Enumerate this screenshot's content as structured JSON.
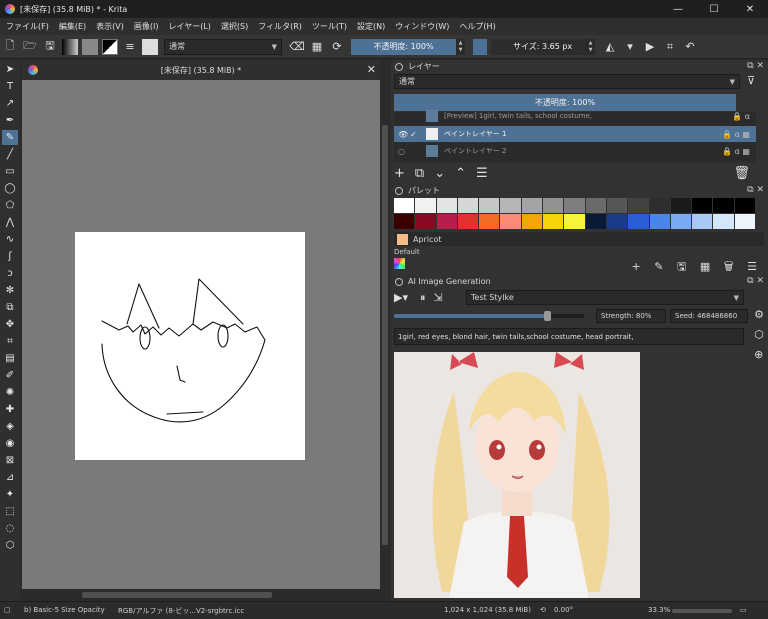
{
  "title_bar": {
    "title": "[未保存] (35.8 MiB) * - Krita",
    "minimize": "—",
    "maximize": "☐",
    "close": "✕"
  },
  "menu": [
    "ファイル(F)",
    "編集(E)",
    "表示(V)",
    "画像(I)",
    "レイヤー(L)",
    "選択(S)",
    "フィルタ(R)",
    "ツール(T)",
    "設定(N)",
    "ウィンドウ(W)",
    "ヘルプ(H)"
  ],
  "toolbar": {
    "blend_mode": "通常",
    "opacity_label": "不透明度: 100%",
    "opacity_value": 100,
    "size_label": "サイズ: 3.65 px"
  },
  "tools": [
    "cursor",
    "text",
    "edit-shapes",
    "calligraphy",
    "brush",
    "line",
    "rectangle",
    "ellipse",
    "polygon",
    "polyline",
    "bezier",
    "freehand-path",
    "dynamic-brush",
    "multibrush",
    "transform",
    "move",
    "crop",
    "gradient",
    "color-picker",
    "colorize-mask",
    "smart-patch",
    "fill",
    "enclose-fill",
    "assistant",
    "measure",
    "reference",
    "rect-select",
    "ellipse-select",
    "poly-select"
  ],
  "canvas": {
    "tab_title": "[未保存] (35.8 MiB) *",
    "close": "✕"
  },
  "layers_docker": {
    "title": "レイヤー",
    "blend_mode": "通常",
    "opacity_label": "不透明度: 100%",
    "layers": [
      {
        "name": "[Preview] 1girl, twin tails, school costume,",
        "selected": false
      },
      {
        "name": "ペイントレイヤー 1",
        "selected": true
      },
      {
        "name": "ペイントレイヤー 2",
        "selected": false
      }
    ]
  },
  "palette_docker": {
    "title": "パレット",
    "row1": [
      "#ffffff",
      "#f2f2f2",
      "#e4e4e4",
      "#d6d6d6",
      "#c6c6c6",
      "#b6b6b6",
      "#a4a4a4",
      "#929292",
      "#7e7e7e",
      "#6a6a6a",
      "#565656",
      "#424242",
      "#2e2e2e",
      "#1a1a1a",
      "#000000",
      "#000000",
      "#000000"
    ],
    "row2": [
      "#3a0000",
      "#8a0a24",
      "#b81e4c",
      "#e0322e",
      "#f46a22",
      "#fb8a7a",
      "#f6a40a",
      "#f7d40a",
      "#f7f23a",
      "#0c1a3a",
      "#1a3a8a",
      "#2a5ed6",
      "#4a86e8",
      "#7aaaf2",
      "#a8c8f6",
      "#d4e6fa",
      "#eef4fc"
    ],
    "selected_color_name": "Apricot",
    "selected_color": "#f6bd88",
    "palette_name": "Default"
  },
  "ai_docker": {
    "title": "AI Image Generation",
    "style": "Test Stylke",
    "strength_label": "Strength: 80%",
    "seed_label": "Seed: 468486860",
    "progress": 0.8,
    "prompt": "1girl, red eyes, blond hair, twin tails,school costume, head portrait,"
  },
  "status_bar": {
    "brush": "b) Basic-5 Size Opacity",
    "color_space": "RGB/アルファ (8-ビッ...V2-srgbtrc.icc",
    "image_size": "1,024 x 1,024 (35.8 MiB)",
    "rotation": "0.00°",
    "zoom": "33.3%"
  },
  "colors": {
    "accent": "#4e7296",
    "canvas_bg": "#7a7a7a",
    "panel_bg": "#323232"
  }
}
